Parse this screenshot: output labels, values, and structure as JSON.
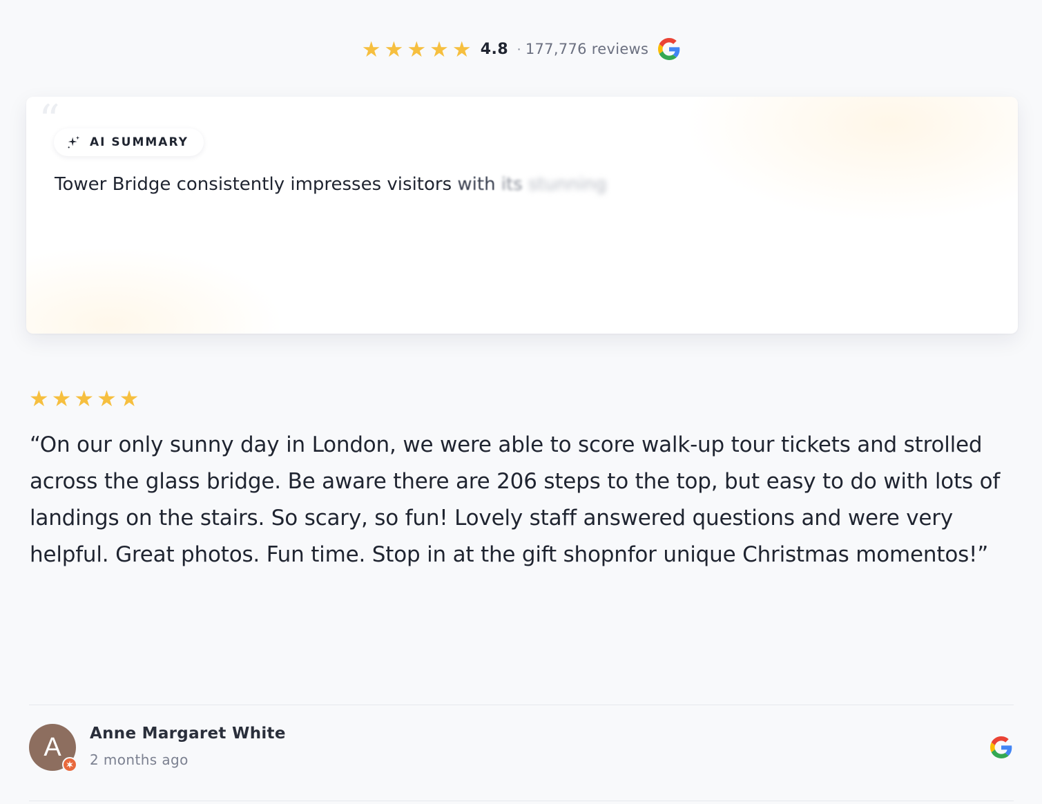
{
  "rating_header": {
    "stars": [
      "★",
      "★",
      "★",
      "★",
      "★"
    ],
    "rating": "4.8",
    "separator": "·",
    "review_count": "177,776 reviews",
    "source_icon": "google-icon"
  },
  "summary": {
    "quote_glyph": "“",
    "badge_icon": "sparkle-icon",
    "badge_label": "AI SUMMARY",
    "text_clear": "Tower Bridge consistently impresses visitors",
    "text_fade_1": " with",
    "text_fade_2": " its",
    "text_fade_3": " stunning"
  },
  "review": {
    "stars": [
      "★",
      "★",
      "★",
      "★",
      "★"
    ],
    "lines": [
      "“On our only sunny day in London, we were able to score walk-up tour tickets and strolled",
      "across the glass bridge. Be aware there are 206 steps to the top, but easy to do with lots of",
      "landings on the stairs. So scary, so fun! Lovely staff answered questions and were very",
      "helpful. Great photos. Fun time. Stop in at the gift shopnfor unique Christmas momentos!”"
    ]
  },
  "author": {
    "initial": "A",
    "name": "Anne Margaret White",
    "time": "2 months ago",
    "source_icon": "google-icon"
  },
  "colors": {
    "star": "#f6bf3f",
    "avatar": "#8d6e5f",
    "badge": "#e8683c",
    "background": "#f8f9fb",
    "text": "#1f2430"
  }
}
